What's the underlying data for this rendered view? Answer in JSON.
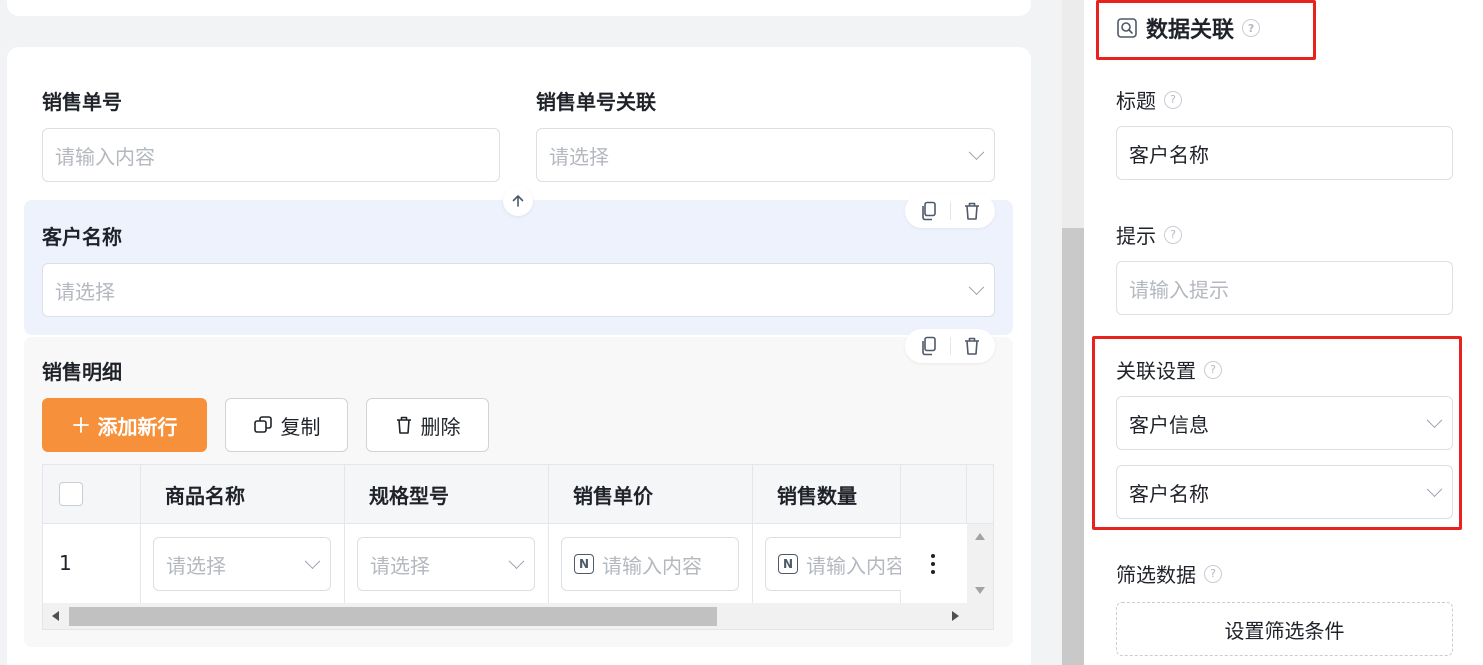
{
  "canvas": {
    "fields": {
      "sales_no": {
        "label": "销售单号",
        "placeholder": "请输入内容"
      },
      "sales_no_link": {
        "label": "销售单号关联",
        "placeholder": "请选择"
      },
      "customer_name": {
        "label": "客户名称",
        "placeholder": "请选择"
      }
    },
    "sub_table": {
      "label": "销售明细",
      "buttons": {
        "add_row": "添加新行",
        "copy": "复制",
        "delete": "删除"
      },
      "columns": [
        "商品名称",
        "规格型号",
        "销售单价",
        "销售数量"
      ],
      "rows": [
        {
          "index": "1",
          "cells": [
            "请选择",
            "请选择",
            "请输入内容",
            "请输入内容"
          ]
        }
      ]
    }
  },
  "panel": {
    "title": "数据关联",
    "title_field": {
      "label": "标题",
      "value": "客户名称"
    },
    "hint_field": {
      "label": "提示",
      "placeholder": "请输入提示"
    },
    "link_settings": {
      "label": "关联设置",
      "form": "客户信息",
      "field": "客户名称"
    },
    "filter": {
      "label": "筛选数据",
      "button": "设置筛选条件"
    }
  },
  "colors": {
    "accent_orange": "#f7903b",
    "selected_bg": "#eef2fd",
    "highlight_red": "#e8231f"
  },
  "icons": [
    "arrow-up-icon",
    "copy-icon",
    "trash-icon",
    "plus-icon",
    "number-field-icon",
    "more-vertical-icon",
    "chevron-down-icon",
    "help-icon",
    "data-link-icon"
  ]
}
